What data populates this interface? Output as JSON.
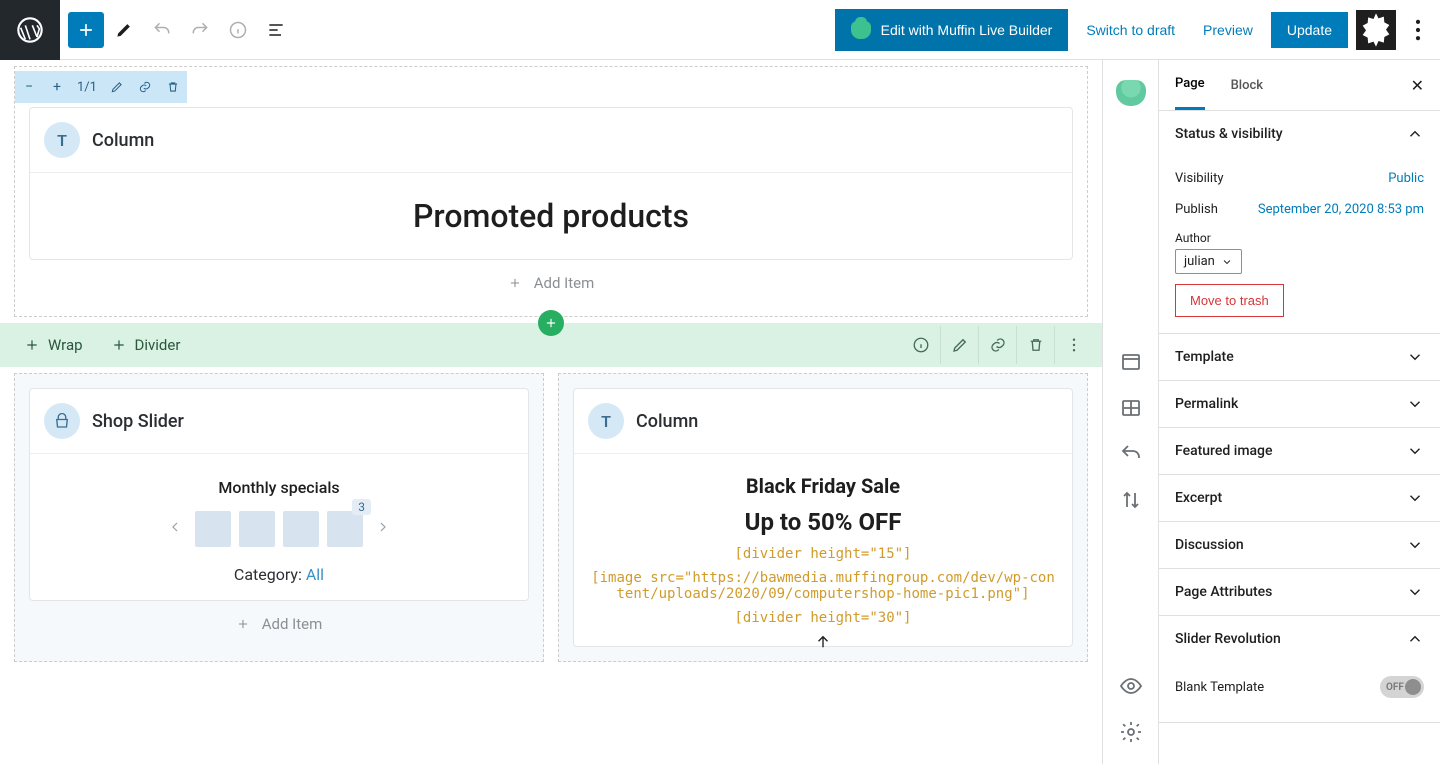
{
  "topbar": {
    "muffin_btn": "Edit with Muffin Live Builder",
    "switch_draft": "Switch to draft",
    "preview": "Preview",
    "update": "Update"
  },
  "section1": {
    "size": "1/1",
    "column_label": "Column",
    "heading": "Promoted products",
    "add_item": "Add Item"
  },
  "greenbar": {
    "wrap": "Wrap",
    "divider": "Divider"
  },
  "shop": {
    "title": "Shop Slider",
    "subtitle": "Monthly specials",
    "count": "3",
    "cat_label": "Category:",
    "cat_value": "All",
    "add_item": "Add Item"
  },
  "bf": {
    "column_label": "Column",
    "h1": "Black Friday Sale",
    "h2": "Up to 50% OFF",
    "c1": "[divider height=\"15\"]",
    "c2": "[image src=\"https://bawmedia.muffingroup.com/dev/wp-content/uploads/2020/09/computershop-home-pic1.png\"]",
    "c3": "[divider height=\"30\"]"
  },
  "sidebar": {
    "tab_page": "Page",
    "tab_block": "Block",
    "status": {
      "title": "Status & visibility",
      "vis_label": "Visibility",
      "vis_value": "Public",
      "pub_label": "Publish",
      "pub_value": "September 20, 2020 8:53 pm",
      "author_label": "Author",
      "author_value": "julian",
      "trash": "Move to trash"
    },
    "template": "Template",
    "permalink": "Permalink",
    "featured": "Featured image",
    "excerpt": "Excerpt",
    "discussion": "Discussion",
    "page_attr": "Page Attributes",
    "slider_rev": "Slider Revolution",
    "blank_tpl": "Blank Template",
    "blank_tpl_state": "OFF"
  }
}
